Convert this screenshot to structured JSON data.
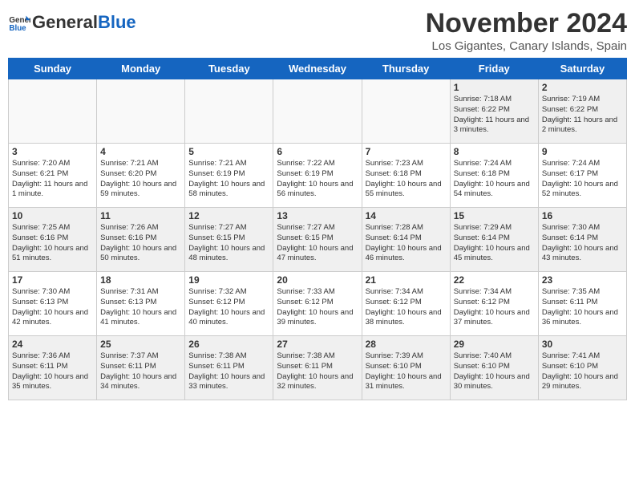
{
  "header": {
    "logo_general": "General",
    "logo_blue": "Blue",
    "month": "November 2024",
    "location": "Los Gigantes, Canary Islands, Spain"
  },
  "days_of_week": [
    "Sunday",
    "Monday",
    "Tuesday",
    "Wednesday",
    "Thursday",
    "Friday",
    "Saturday"
  ],
  "weeks": [
    [
      {
        "day": "",
        "info": ""
      },
      {
        "day": "",
        "info": ""
      },
      {
        "day": "",
        "info": ""
      },
      {
        "day": "",
        "info": ""
      },
      {
        "day": "",
        "info": ""
      },
      {
        "day": "1",
        "info": "Sunrise: 7:18 AM\nSunset: 6:22 PM\nDaylight: 11 hours and 3 minutes."
      },
      {
        "day": "2",
        "info": "Sunrise: 7:19 AM\nSunset: 6:22 PM\nDaylight: 11 hours and 2 minutes."
      }
    ],
    [
      {
        "day": "3",
        "info": "Sunrise: 7:20 AM\nSunset: 6:21 PM\nDaylight: 11 hours and 1 minute."
      },
      {
        "day": "4",
        "info": "Sunrise: 7:21 AM\nSunset: 6:20 PM\nDaylight: 10 hours and 59 minutes."
      },
      {
        "day": "5",
        "info": "Sunrise: 7:21 AM\nSunset: 6:19 PM\nDaylight: 10 hours and 58 minutes."
      },
      {
        "day": "6",
        "info": "Sunrise: 7:22 AM\nSunset: 6:19 PM\nDaylight: 10 hours and 56 minutes."
      },
      {
        "day": "7",
        "info": "Sunrise: 7:23 AM\nSunset: 6:18 PM\nDaylight: 10 hours and 55 minutes."
      },
      {
        "day": "8",
        "info": "Sunrise: 7:24 AM\nSunset: 6:18 PM\nDaylight: 10 hours and 54 minutes."
      },
      {
        "day": "9",
        "info": "Sunrise: 7:24 AM\nSunset: 6:17 PM\nDaylight: 10 hours and 52 minutes."
      }
    ],
    [
      {
        "day": "10",
        "info": "Sunrise: 7:25 AM\nSunset: 6:16 PM\nDaylight: 10 hours and 51 minutes."
      },
      {
        "day": "11",
        "info": "Sunrise: 7:26 AM\nSunset: 6:16 PM\nDaylight: 10 hours and 50 minutes."
      },
      {
        "day": "12",
        "info": "Sunrise: 7:27 AM\nSunset: 6:15 PM\nDaylight: 10 hours and 48 minutes."
      },
      {
        "day": "13",
        "info": "Sunrise: 7:27 AM\nSunset: 6:15 PM\nDaylight: 10 hours and 47 minutes."
      },
      {
        "day": "14",
        "info": "Sunrise: 7:28 AM\nSunset: 6:14 PM\nDaylight: 10 hours and 46 minutes."
      },
      {
        "day": "15",
        "info": "Sunrise: 7:29 AM\nSunset: 6:14 PM\nDaylight: 10 hours and 45 minutes."
      },
      {
        "day": "16",
        "info": "Sunrise: 7:30 AM\nSunset: 6:14 PM\nDaylight: 10 hours and 43 minutes."
      }
    ],
    [
      {
        "day": "17",
        "info": "Sunrise: 7:30 AM\nSunset: 6:13 PM\nDaylight: 10 hours and 42 minutes."
      },
      {
        "day": "18",
        "info": "Sunrise: 7:31 AM\nSunset: 6:13 PM\nDaylight: 10 hours and 41 minutes."
      },
      {
        "day": "19",
        "info": "Sunrise: 7:32 AM\nSunset: 6:12 PM\nDaylight: 10 hours and 40 minutes."
      },
      {
        "day": "20",
        "info": "Sunrise: 7:33 AM\nSunset: 6:12 PM\nDaylight: 10 hours and 39 minutes."
      },
      {
        "day": "21",
        "info": "Sunrise: 7:34 AM\nSunset: 6:12 PM\nDaylight: 10 hours and 38 minutes."
      },
      {
        "day": "22",
        "info": "Sunrise: 7:34 AM\nSunset: 6:12 PM\nDaylight: 10 hours and 37 minutes."
      },
      {
        "day": "23",
        "info": "Sunrise: 7:35 AM\nSunset: 6:11 PM\nDaylight: 10 hours and 36 minutes."
      }
    ],
    [
      {
        "day": "24",
        "info": "Sunrise: 7:36 AM\nSunset: 6:11 PM\nDaylight: 10 hours and 35 minutes."
      },
      {
        "day": "25",
        "info": "Sunrise: 7:37 AM\nSunset: 6:11 PM\nDaylight: 10 hours and 34 minutes."
      },
      {
        "day": "26",
        "info": "Sunrise: 7:38 AM\nSunset: 6:11 PM\nDaylight: 10 hours and 33 minutes."
      },
      {
        "day": "27",
        "info": "Sunrise: 7:38 AM\nSunset: 6:11 PM\nDaylight: 10 hours and 32 minutes."
      },
      {
        "day": "28",
        "info": "Sunrise: 7:39 AM\nSunset: 6:10 PM\nDaylight: 10 hours and 31 minutes."
      },
      {
        "day": "29",
        "info": "Sunrise: 7:40 AM\nSunset: 6:10 PM\nDaylight: 10 hours and 30 minutes."
      },
      {
        "day": "30",
        "info": "Sunrise: 7:41 AM\nSunset: 6:10 PM\nDaylight: 10 hours and 29 minutes."
      }
    ]
  ]
}
